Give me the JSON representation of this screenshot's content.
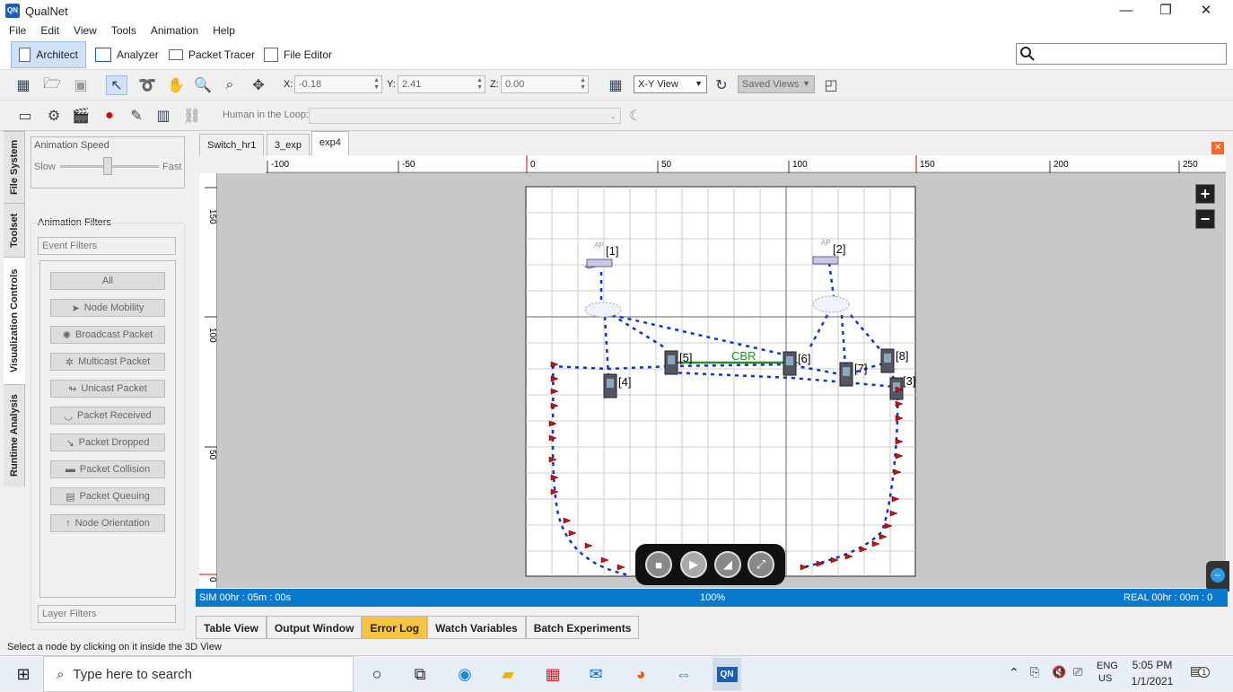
{
  "window": {
    "title": "QualNet",
    "app_icon": "QN",
    "minimize": "—",
    "restore": "❐",
    "close": "✕"
  },
  "menu": [
    "File",
    "Edit",
    "View",
    "Tools",
    "Animation",
    "Help"
  ],
  "modes": {
    "architect": "Architect",
    "analyzer": "Analyzer",
    "packet_tracer": "Packet Tracer",
    "file_editor": "File Editor"
  },
  "coords": {
    "x_label": "X:",
    "x": "-0.18",
    "y_label": "Y:",
    "y": "2.41",
    "z_label": "Z:",
    "z": "0.00"
  },
  "view": {
    "mode": "X-Y View",
    "saved": "Saved Views"
  },
  "hitl": {
    "label": "Human in the Loop:"
  },
  "vtabs": [
    "File System",
    "Toolset",
    "Visualization Controls",
    "Runtime Analysis"
  ],
  "anim": {
    "speed_title": "Animation Speed",
    "slow": "Slow",
    "fast": "Fast",
    "speed_level": 0.48,
    "filters_title": "Animation Filters",
    "event_filters": "Event Filters",
    "layer_filters": "Layer Filters",
    "filters": [
      "All",
      "Node Mobility",
      "Broadcast Packet",
      "Multicast Packet",
      "Unicast Packet",
      "Packet Received",
      "Packet Dropped",
      "Packet Collision",
      "Packet Queuing",
      "Node Orientation"
    ]
  },
  "doc_tabs": [
    "Switch_hr1",
    "3_exp",
    "exp4"
  ],
  "ruler": {
    "h_ticks": [
      "-100",
      "-50",
      "0",
      "50",
      "100",
      "150",
      "200",
      "250"
    ],
    "v_ticks": [
      "150",
      "100",
      "50",
      "0"
    ]
  },
  "scene": {
    "nodes": [
      {
        "id": "1",
        "label": "[1]",
        "type": "ap"
      },
      {
        "id": "2",
        "label": "[2]",
        "type": "ap"
      },
      {
        "id": "3",
        "label": "[3]",
        "type": "device"
      },
      {
        "id": "4",
        "label": "[4]",
        "type": "device"
      },
      {
        "id": "5",
        "label": "[5]",
        "type": "device"
      },
      {
        "id": "6",
        "label": "[6]",
        "type": "device"
      },
      {
        "id": "7",
        "label": "[7]",
        "type": "device"
      },
      {
        "id": "8",
        "label": "[8]",
        "type": "device"
      }
    ],
    "ap_tag": "AP",
    "link_label": "CBR"
  },
  "status_strip": {
    "sim": "SIM 00hr : 05m : 00s",
    "pct": "100%",
    "real": "REAL 00hr : 00m : 0"
  },
  "bottom_tabs": [
    "Table View",
    "Output Window",
    "Error Log",
    "Watch Variables",
    "Batch Experiments"
  ],
  "statusbar": "Select a node by clicking on it inside the 3D View",
  "taskbar": {
    "search": "Type here to search",
    "lang1": "ENG",
    "lang2": "US",
    "time": "5:05 PM",
    "date": "1/1/2021",
    "notif": "1"
  },
  "colors": {
    "accent": "#0a79cc",
    "error_tab": "#f7c343",
    "link": "#1133cc",
    "cbr": "#2a8a2a",
    "flag": "#cc1111"
  }
}
